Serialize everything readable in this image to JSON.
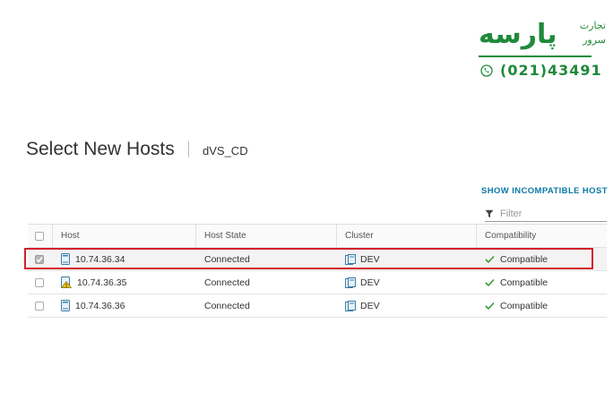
{
  "logo": {
    "brand": "پارسه",
    "sub1": "تجارت",
    "sub2": "سرور",
    "phone": "(021)43491",
    "accent_color": "#1f8a3b"
  },
  "page": {
    "title": "Select New Hosts",
    "subtitle": "dVS_CD"
  },
  "actions": {
    "show_incompatible": "SHOW INCOMPATIBLE HOST"
  },
  "filter": {
    "placeholder": "Filter",
    "icon": "funnel-icon"
  },
  "table": {
    "columns": [
      "Host",
      "Host State",
      "Cluster",
      "Compatibility"
    ],
    "rows": [
      {
        "selected": true,
        "host": "10.74.36.34",
        "host_icon": "host-icon",
        "state": "Connected",
        "cluster": "DEV",
        "compatibility": "Compatible"
      },
      {
        "selected": false,
        "host": "10.74.36.35",
        "host_icon": "host-warning-icon",
        "state": "Connected",
        "cluster": "DEV",
        "compatibility": "Compatible"
      },
      {
        "selected": false,
        "host": "10.74.36.36",
        "host_icon": "host-icon",
        "state": "Connected",
        "cluster": "DEV",
        "compatibility": "Compatible"
      }
    ]
  },
  "colors": {
    "link": "#0b78a8",
    "compatible": "#3a9a3a",
    "highlight": "#d3202c"
  }
}
